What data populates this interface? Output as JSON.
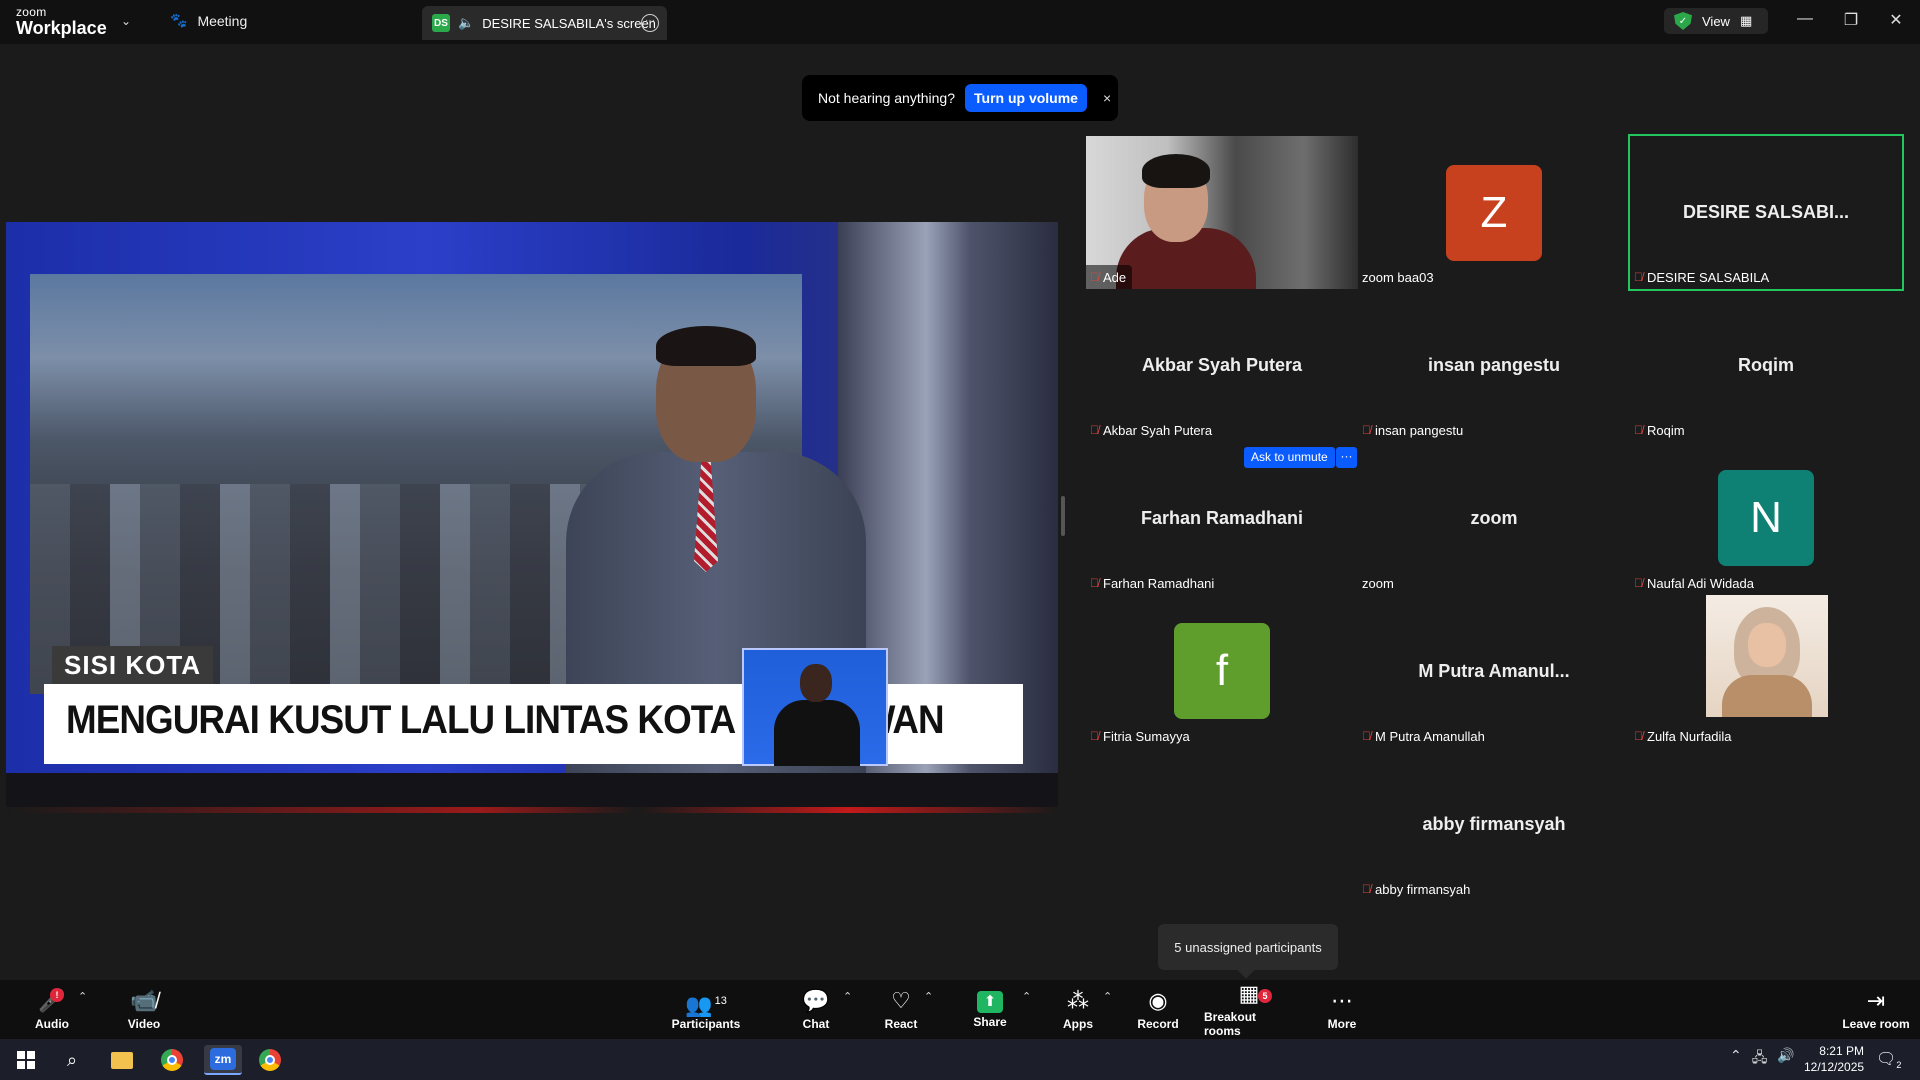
{
  "title_bar": {
    "brand_small": "zoom",
    "brand_big": "Workplace",
    "meeting_tab": "Meeting",
    "share_tab_badge": "DS",
    "share_tab_label": "DESIRE SALSABILA's screen",
    "view_label": "View"
  },
  "toast": {
    "message": "Not hearing anything?",
    "button": "Turn up volume",
    "close": "×"
  },
  "shared_screen": {
    "segment_label": "SISI KOTA",
    "headline": "MENGURAI KUSUT LALU LINTAS KOTA PAHLAWAN"
  },
  "gallery": {
    "tiles": [
      {
        "display": "",
        "name": "Ade",
        "muted": true
      },
      {
        "display": "Z",
        "name": "zoom baa03",
        "muted": false,
        "avatar_color": "#c8411e"
      },
      {
        "display": "DESIRE  SALSABI...",
        "name": "DESIRE SALSABILA",
        "muted": true,
        "active": true
      },
      {
        "display": "Akbar Syah Putera",
        "name": "Akbar Syah Putera",
        "muted": true
      },
      {
        "display": "insan pangestu",
        "name": "insan pangestu",
        "muted": true
      },
      {
        "display": "Roqim",
        "name": "Roqim",
        "muted": true
      },
      {
        "display": "Farhan Ramadhani",
        "name": "Farhan Ramadhani",
        "muted": true
      },
      {
        "display": "zoom",
        "name": "zoom",
        "muted": false
      },
      {
        "display": "N",
        "name": "Naufal Adi Widada",
        "muted": true,
        "avatar_color": "#0e8074"
      },
      {
        "display": "f",
        "name": "Fitria Sumayya",
        "muted": true,
        "avatar_color": "#5f9e2c"
      },
      {
        "display": "M  Putra Amanul...",
        "name": "M Putra Amanullah",
        "muted": true
      },
      {
        "display": "",
        "name": "Zulfa Nurfadila",
        "muted": true
      },
      {
        "display": "abby firmansyah",
        "name": "abby firmansyah",
        "muted": true
      }
    ],
    "ask_to_unmute": "Ask to unmute",
    "ask_more": "···"
  },
  "tooltip": {
    "unassigned": "5 unassigned participants"
  },
  "toolbar": {
    "audio": "Audio",
    "video": "Video",
    "participants": "Participants",
    "participants_count": "13",
    "chat": "Chat",
    "react": "React",
    "share": "Share",
    "apps": "Apps",
    "record": "Record",
    "breakout_rooms": "Breakout rooms",
    "breakout_badge": "5",
    "more": "More",
    "leave": "Leave room"
  },
  "taskbar": {
    "time": "8:21 PM",
    "date": "12/12/2025",
    "zoom_app": "zm",
    "notification_count": "2"
  },
  "colors": {
    "accent": "#0b5cff",
    "active_border": "#22c55e",
    "muted_icon": "#e0463c"
  }
}
